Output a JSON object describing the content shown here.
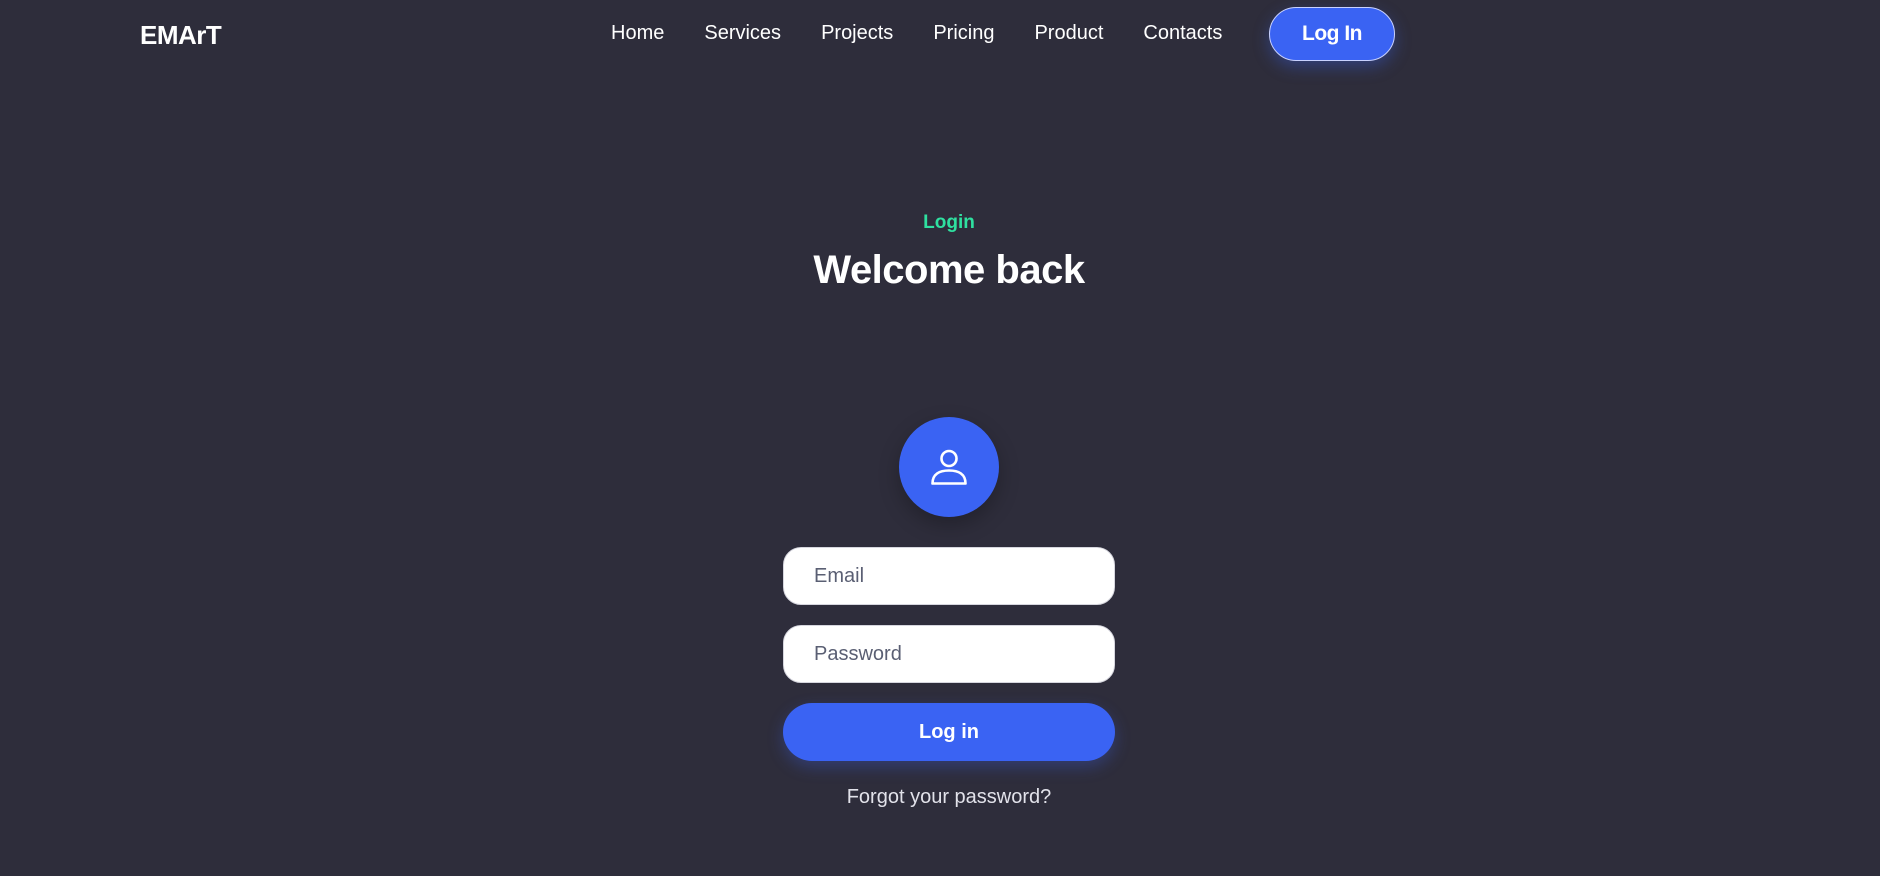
{
  "brand": {
    "name": "EMArT"
  },
  "nav": {
    "items": [
      {
        "label": "Home"
      },
      {
        "label": "Services"
      },
      {
        "label": "Projects"
      },
      {
        "label": "Pricing"
      },
      {
        "label": "Product"
      },
      {
        "label": "Contacts"
      }
    ],
    "login_label": "Log In"
  },
  "hero": {
    "eyebrow": "Login",
    "title": "Welcome back"
  },
  "form": {
    "avatar_icon": "user-icon",
    "email_placeholder": "Email",
    "password_placeholder": "Password",
    "submit_label": "Log in",
    "forgot_label": "Forgot your password?"
  },
  "colors": {
    "background": "#2e2d3b",
    "accent": "#3a63f3",
    "eyebrow": "#2fe0a0",
    "input_background": "#ffffff"
  }
}
